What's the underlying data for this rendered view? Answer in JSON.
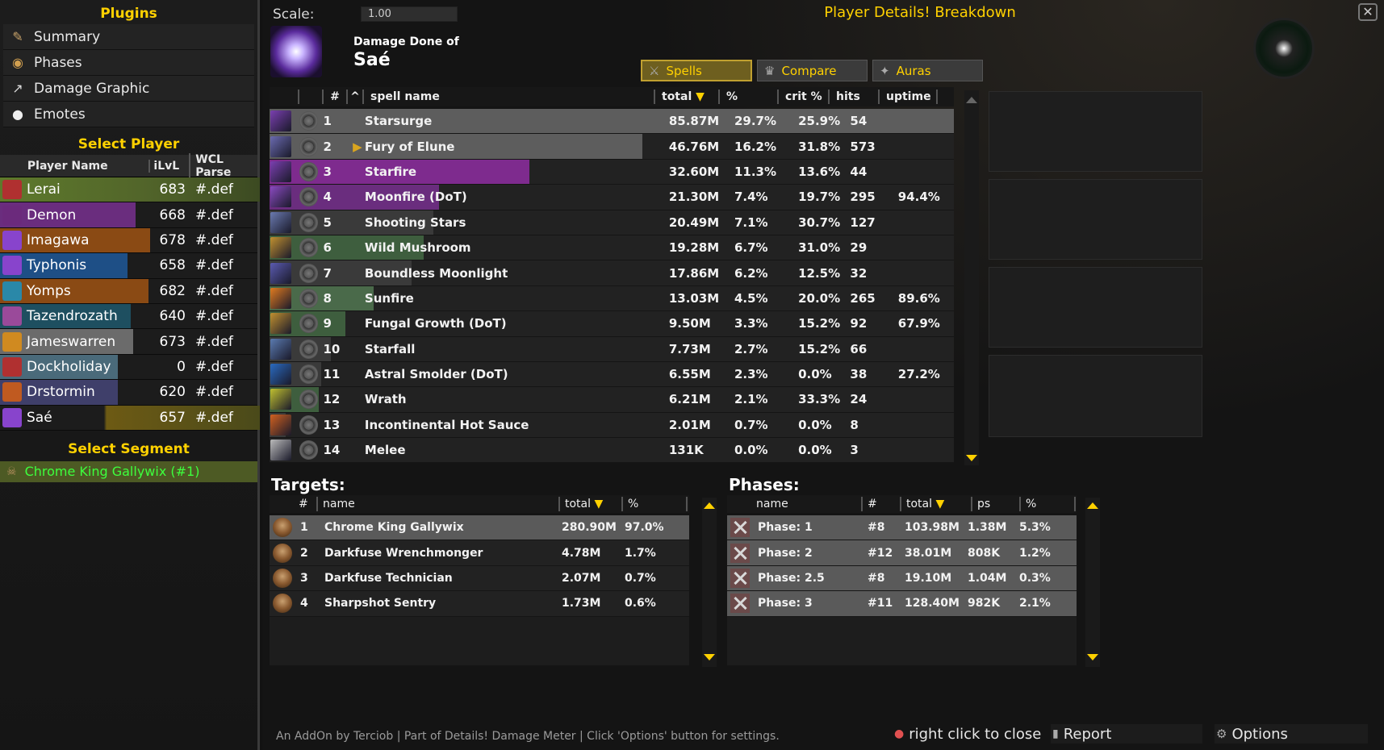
{
  "sidebar": {
    "plugins_title": "Plugins",
    "plugins": [
      {
        "label": "Summary",
        "icon": "scroll-icon",
        "color": "#c8a36a"
      },
      {
        "label": "Phases",
        "icon": "compass-icon",
        "color": "#d2a050"
      },
      {
        "label": "Damage Graphic",
        "icon": "chart-line-icon",
        "color": "#dddddd"
      },
      {
        "label": "Emotes",
        "icon": "speech-bubble-icon",
        "color": "#eeeeee"
      }
    ],
    "select_player_title": "Select Player",
    "player_headers": {
      "name": "Player Name",
      "ilvl": "iLvL",
      "wcl": "WCL Parse"
    },
    "players": [
      {
        "name": "Lerai",
        "ilvl": "683",
        "parse": "#.def",
        "color": "#5e7a2c",
        "icon_color": "#b03030"
      },
      {
        "name": "Demon",
        "ilvl": "668",
        "parse": "#.def",
        "color": "#6a2d7e",
        "icon_color": "#6b2a7c"
      },
      {
        "name": "Imagawa",
        "ilvl": "678",
        "parse": "#.def",
        "color": "#8a4a14",
        "icon_color": "#8844cc"
      },
      {
        "name": "Typhonis",
        "ilvl": "658",
        "parse": "#.def",
        "color": "#1e4f86",
        "icon_color": "#8844cc"
      },
      {
        "name": "Yomps",
        "ilvl": "682",
        "parse": "#.def",
        "color": "#8a4a14",
        "icon_color": "#2a88a8"
      },
      {
        "name": "Tazendrozath",
        "ilvl": "640",
        "parse": "#.def",
        "color": "#1e4f60",
        "icon_color": "#9a4a9a"
      },
      {
        "name": "Jameswarren",
        "ilvl": "673",
        "parse": "#.def",
        "color": "#6b6b6b",
        "icon_color": "#d08a20"
      },
      {
        "name": "Dockholiday",
        "ilvl": "0",
        "parse": "#.def",
        "color": "#4a6a7a",
        "icon_color": "#b03030"
      },
      {
        "name": "Drstormin",
        "ilvl": "620",
        "parse": "#.def",
        "color": "#3f3f6a",
        "icon_color": "#c05a20"
      },
      {
        "name": "Saé",
        "ilvl": "657",
        "parse": "#.def",
        "color": "#8a6a14",
        "icon_color": "#8844cc"
      }
    ],
    "select_segment_title": "Select Segment",
    "segment": "Chrome King Gallywix (#1)"
  },
  "header": {
    "scale_label": "Scale:",
    "scale_value": "1.00",
    "window_title": "Player Details! Breakdown",
    "damage_done_of": "Damage Done of",
    "player_name": "Saé",
    "tabs": [
      {
        "label": "Spells",
        "icon": "crossed-swords-icon",
        "active": true
      },
      {
        "label": "Compare",
        "icon": "crown-icon",
        "active": false
      },
      {
        "label": "Auras",
        "icon": "aura-icon",
        "active": false
      }
    ]
  },
  "spells": {
    "headers": {
      "rank": "#",
      "sort": "^",
      "name": "spell name",
      "total": "total",
      "pct": "%",
      "crit": "crit %",
      "hits": "hits",
      "uptime": "uptime"
    },
    "rows": [
      {
        "rank": "1",
        "name": "Starsurge",
        "total": "85.87M",
        "pct": "29.7%",
        "crit": "25.9%",
        "hits": "54",
        "uptime": "",
        "bar": 1.0,
        "bar_color": "#5d5d5d",
        "icon_color": "#7a3fb0",
        "expand": false
      },
      {
        "rank": "2",
        "name": "Fury of Elune",
        "total": "46.76M",
        "pct": "16.2%",
        "crit": "31.8%",
        "hits": "573",
        "uptime": "",
        "bar": 0.545,
        "bar_color": "#5d5d5d",
        "icon_color": "#6a6ab0",
        "expand": true
      },
      {
        "rank": "3",
        "name": "Starfire",
        "total": "32.60M",
        "pct": "11.3%",
        "crit": "13.6%",
        "hits": "44",
        "uptime": "",
        "bar": 0.38,
        "bar_color": "#7e2b8e",
        "icon_color": "#7a3fb0",
        "expand": false
      },
      {
        "rank": "4",
        "name": "Moonfire (DoT)",
        "total": "21.30M",
        "pct": "7.4%",
        "crit": "19.7%",
        "hits": "295",
        "uptime": "94.4%",
        "bar": 0.248,
        "bar_color": "#6a2d7e",
        "icon_color": "#8a4ac0",
        "expand": false
      },
      {
        "rank": "5",
        "name": "Shooting Stars",
        "total": "20.49M",
        "pct": "7.1%",
        "crit": "30.7%",
        "hits": "127",
        "uptime": "",
        "bar": 0.239,
        "bar_color": "#3a3a3a",
        "icon_color": "#6a7ab0",
        "expand": false
      },
      {
        "rank": "6",
        "name": "Wild Mushroom",
        "total": "19.28M",
        "pct": "6.7%",
        "crit": "31.0%",
        "hits": "29",
        "uptime": "",
        "bar": 0.225,
        "bar_color": "#3e5e3e",
        "icon_color": "#c09030",
        "expand": false
      },
      {
        "rank": "7",
        "name": "Boundless Moonlight",
        "total": "17.86M",
        "pct": "6.2%",
        "crit": "12.5%",
        "hits": "32",
        "uptime": "",
        "bar": 0.208,
        "bar_color": "#3a3a3a",
        "icon_color": "#5a5ab0",
        "expand": false
      },
      {
        "rank": "8",
        "name": "Sunfire",
        "total": "13.03M",
        "pct": "4.5%",
        "crit": "20.0%",
        "hits": "265",
        "uptime": "89.6%",
        "bar": 0.152,
        "bar_color": "#4a6a4a",
        "icon_color": "#e07a20",
        "expand": false
      },
      {
        "rank": "9",
        "name": "Fungal Growth (DoT)",
        "total": "9.50M",
        "pct": "3.3%",
        "crit": "15.2%",
        "hits": "92",
        "uptime": "67.9%",
        "bar": 0.111,
        "bar_color": "#3e5e3e",
        "icon_color": "#c09030",
        "expand": false
      },
      {
        "rank": "10",
        "name": "Starfall",
        "total": "7.73M",
        "pct": "2.7%",
        "crit": "15.2%",
        "hits": "66",
        "uptime": "",
        "bar": 0.09,
        "bar_color": "#3a3a3a",
        "icon_color": "#5a7ab0",
        "expand": false
      },
      {
        "rank": "11",
        "name": "Astral Smolder (DoT)",
        "total": "6.55M",
        "pct": "2.3%",
        "crit": "0.0%",
        "hits": "38",
        "uptime": "27.2%",
        "bar": 0.076,
        "bar_color": "#3a3a3a",
        "icon_color": "#2a6ac0",
        "expand": false
      },
      {
        "rank": "12",
        "name": "Wrath",
        "total": "6.21M",
        "pct": "2.1%",
        "crit": "33.3%",
        "hits": "24",
        "uptime": "",
        "bar": 0.072,
        "bar_color": "#3e5e3e",
        "icon_color": "#c0c030",
        "expand": false
      },
      {
        "rank": "13",
        "name": "Incontinental Hot Sauce",
        "total": "2.01M",
        "pct": "0.7%",
        "crit": "0.0%",
        "hits": "8",
        "uptime": "",
        "bar": 0.023,
        "bar_color": "#3a3a3a",
        "icon_color": "#d06020",
        "expand": false
      },
      {
        "rank": "14",
        "name": "Melee",
        "total": "131K",
        "pct": "0.0%",
        "crit": "0.0%",
        "hits": "3",
        "uptime": "",
        "bar": 0.0,
        "bar_color": "#3a3a3a",
        "icon_color": "#bbbbbb",
        "expand": false
      }
    ]
  },
  "targets": {
    "title": "Targets:",
    "headers": {
      "rank": "#",
      "name": "name",
      "total": "total",
      "pct": "%"
    },
    "rows": [
      {
        "rank": "1",
        "name": "Chrome King Gallywix",
        "total": "280.90M",
        "pct": "97.0%"
      },
      {
        "rank": "2",
        "name": "Darkfuse Wrenchmonger",
        "total": "4.78M",
        "pct": "1.7%"
      },
      {
        "rank": "3",
        "name": "Darkfuse Technician",
        "total": "2.07M",
        "pct": "0.7%"
      },
      {
        "rank": "4",
        "name": "Sharpshot Sentry",
        "total": "1.73M",
        "pct": "0.6%"
      }
    ]
  },
  "phases": {
    "title": "Phases:",
    "headers": {
      "name": "name",
      "rank": "#",
      "total": "total",
      "ps": "ps",
      "pct": "%"
    },
    "rows": [
      {
        "name": "Phase: 1",
        "rank": "#8",
        "total": "103.98M",
        "ps": "1.38M",
        "pct": "5.3%"
      },
      {
        "name": "Phase: 2",
        "rank": "#12",
        "total": "38.01M",
        "ps": "808K",
        "pct": "1.2%"
      },
      {
        "name": "Phase: 2.5",
        "rank": "#8",
        "total": "19.10M",
        "ps": "1.04M",
        "pct": "0.3%"
      },
      {
        "name": "Phase: 3",
        "rank": "#11",
        "total": "128.40M",
        "ps": "982K",
        "pct": "2.1%"
      }
    ]
  },
  "footer": {
    "credits": "An AddOn by Terciob | Part of Details! Damage Meter | Click 'Options' button for settings.",
    "right_click": "right click to close",
    "report": "Report",
    "options": "Options"
  }
}
